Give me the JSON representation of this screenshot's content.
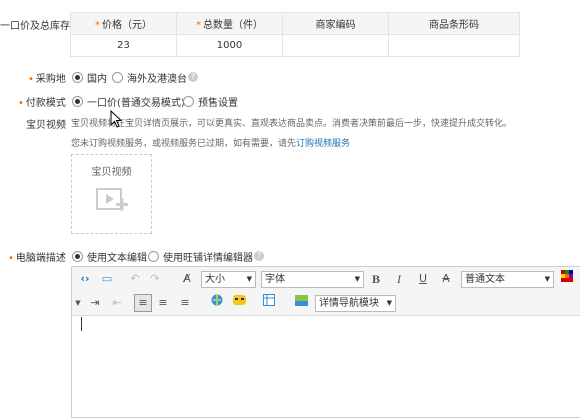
{
  "price_section": {
    "label": "一口价及总库存",
    "headers": [
      {
        "req": "*",
        "text": "价格（元）"
      },
      {
        "req": "*",
        "text": "总数量（件）"
      },
      {
        "req": "",
        "text": "商家编码"
      },
      {
        "req": "",
        "text": "商品条形码"
      }
    ],
    "row": [
      "23",
      "1000",
      "",
      ""
    ]
  },
  "purchase": {
    "label": "采购地",
    "options": [
      {
        "label": "国内",
        "selected": true
      },
      {
        "label": "海外及港澳台",
        "selected": false
      }
    ]
  },
  "payment": {
    "label": "付款模式",
    "options": [
      {
        "label": "一口价(普通交易模式)",
        "selected": true
      },
      {
        "label": "预售设置",
        "selected": false
      }
    ]
  },
  "video": {
    "label": "宝贝视频",
    "desc_line1": "宝贝视频将在宝贝详情页展示，可以更真实、直观表达商品卖点。消费者决策前最后一步，快速提升成交转化。",
    "desc_line2_prefix": "您未订购视频服务，或视频服务已过期，如有需要，请先",
    "order_link": "订购视频服务",
    "upload_label": "宝贝视频"
  },
  "pc_desc": {
    "label": "电脑端描述",
    "options": [
      {
        "label": "使用文本编辑",
        "selected": true
      },
      {
        "label": "使用旺铺详情编辑器",
        "selected": false
      }
    ]
  },
  "editor": {
    "font_size": "大小",
    "font_family": "字体",
    "bold": "B",
    "italic": "I",
    "underline": "U",
    "strike": "A",
    "format": "普通文本",
    "nav_module": "详情导航模块"
  },
  "colors": {
    "required": "#ff6600",
    "link": "#1e73b0",
    "accent": "#f60"
  }
}
